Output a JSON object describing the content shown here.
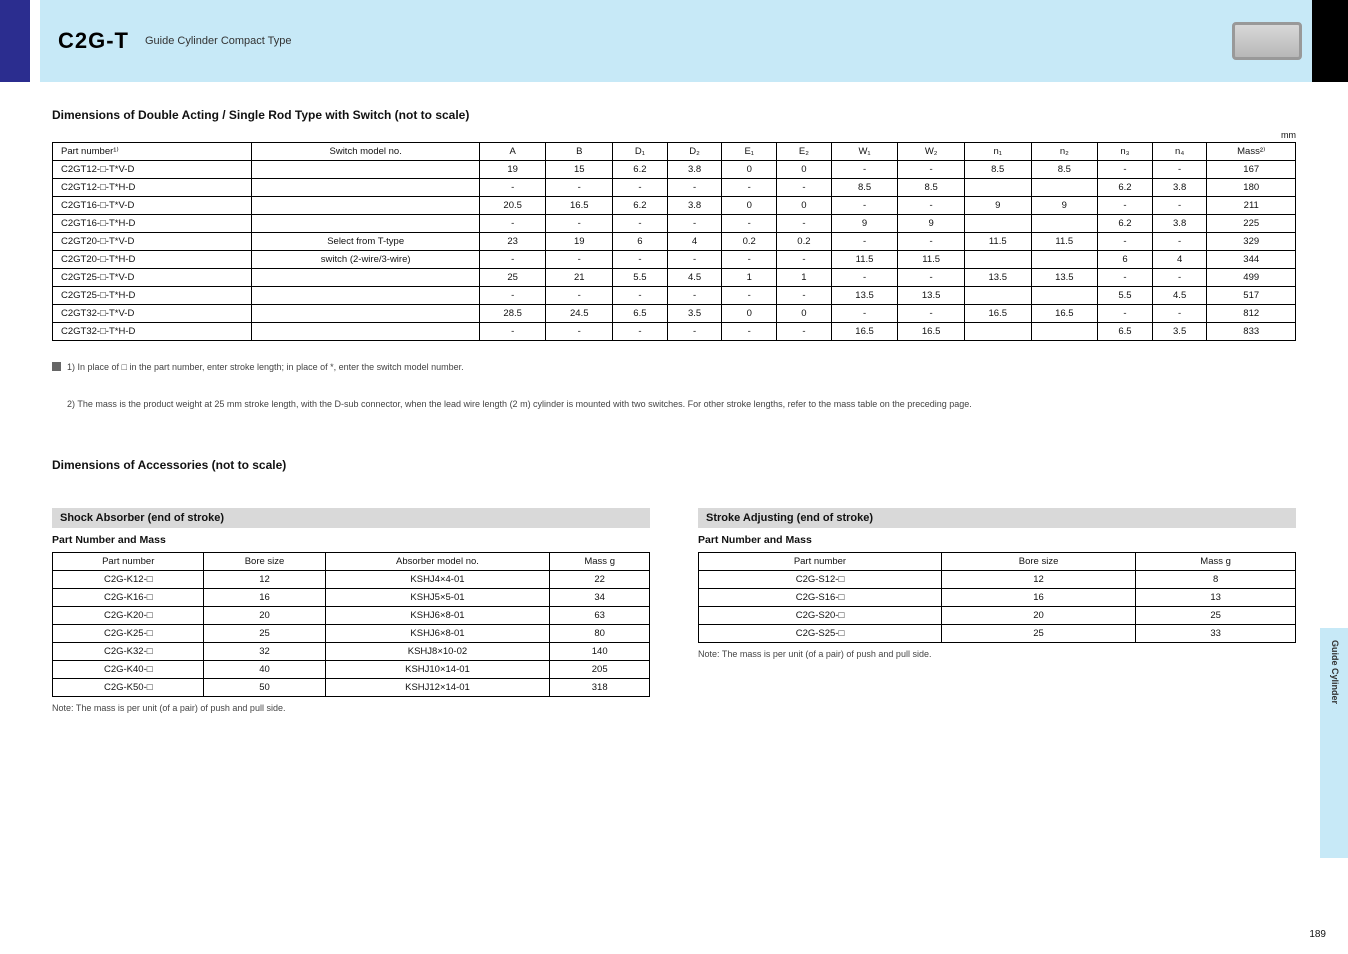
{
  "header": {
    "series": "C2G-T",
    "subtitle": "Guide Cylinder Compact Type",
    "side_tab": "Guide Cylinder",
    "page_number": "189"
  },
  "main_table": {
    "title": "Dimensions of Double Acting / Single Rod Type with Switch (not to scale)",
    "unit_note": "mm",
    "headers_row1": [
      "Part number¹⁾",
      "Switch model no.",
      "A",
      "B",
      "D₁",
      "D₂",
      "E₁",
      "E₂",
      "W₁",
      "W₂",
      "n₁",
      "n₂",
      "n₃",
      "n₄",
      "Mass²⁾"
    ],
    "rows": [
      [
        "C2GT12-□-T*V-D",
        "",
        "19",
        "15",
        "6.2",
        "3.8",
        "0",
        "0",
        "-",
        "-",
        "8.5",
        "8.5",
        "-",
        "-",
        "167"
      ],
      [
        "C2GT12-□-T*H-D",
        "",
        "-",
        "-",
        "-",
        "-",
        "-",
        "-",
        "8.5",
        "8.5",
        "",
        "",
        "6.2",
        "3.8",
        "180"
      ],
      [
        "C2GT16-□-T*V-D",
        "",
        "20.5",
        "16.5",
        "6.2",
        "3.8",
        "0",
        "0",
        "-",
        "-",
        "9",
        "9",
        "-",
        "-",
        "211"
      ],
      [
        "C2GT16-□-T*H-D",
        "",
        "-",
        "-",
        "-",
        "-",
        "-",
        "-",
        "9",
        "9",
        "",
        "",
        "6.2",
        "3.8",
        "225"
      ],
      [
        "C2GT20-□-T*V-D",
        "Select from T-type",
        "23",
        "19",
        "6",
        "4",
        "0.2",
        "0.2",
        "-",
        "-",
        "11.5",
        "11.5",
        "-",
        "-",
        "329"
      ],
      [
        "C2GT20-□-T*H-D",
        "switch (2-wire/3-wire)",
        "-",
        "-",
        "-",
        "-",
        "-",
        "-",
        "11.5",
        "11.5",
        "",
        "",
        "6",
        "4",
        "344"
      ],
      [
        "C2GT25-□-T*V-D",
        "",
        "25",
        "21",
        "5.5",
        "4.5",
        "1",
        "1",
        "-",
        "-",
        "13.5",
        "13.5",
        "-",
        "-",
        "499"
      ],
      [
        "C2GT25-□-T*H-D",
        "",
        "-",
        "-",
        "-",
        "-",
        "-",
        "-",
        "13.5",
        "13.5",
        "",
        "",
        "5.5",
        "4.5",
        "517"
      ],
      [
        "C2GT32-□-T*V-D",
        "",
        "28.5",
        "24.5",
        "6.5",
        "3.5",
        "0",
        "0",
        "-",
        "-",
        "16.5",
        "16.5",
        "-",
        "-",
        "812"
      ],
      [
        "C2GT32-□-T*H-D",
        "",
        "-",
        "-",
        "-",
        "-",
        "-",
        "-",
        "16.5",
        "16.5",
        "",
        "",
        "6.5",
        "3.5",
        "833"
      ]
    ],
    "notes": [
      "1) In place of □ in the part number, enter stroke length; in place of *, enter the switch model number.",
      "2) The mass is the product weight at 25 mm stroke length, with the D-sub connector, when the lead wire length (2 m) cylinder is mounted with two switches. For other stroke lengths, refer to the mass table on the preceding page."
    ]
  },
  "accessories_heading": "Dimensions of Accessories (not to scale)",
  "shock_absorber": {
    "bar": "Shock Absorber (end of stroke)",
    "sub": "Part Number and Mass",
    "headers": [
      "Part number",
      "Bore size",
      "Absorber model no.",
      "Mass g"
    ],
    "rows": [
      [
        "C2G-K12-□",
        "12",
        "KSHJ4×4-01",
        "22"
      ],
      [
        "C2G-K16-□",
        "16",
        "KSHJ5×5-01",
        "34"
      ],
      [
        "C2G-K20-□",
        "20",
        "KSHJ6×8-01",
        "63"
      ],
      [
        "C2G-K25-□",
        "25",
        "KSHJ6×8-01",
        "80"
      ],
      [
        "C2G-K32-□",
        "32",
        "KSHJ8×10-02",
        "140"
      ],
      [
        "C2G-K40-□",
        "40",
        "KSHJ10×14-01",
        "205"
      ],
      [
        "C2G-K50-□",
        "50",
        "KSHJ12×14-01",
        "318"
      ]
    ],
    "note": "Note: The mass is per unit (of a pair) of push and pull side."
  },
  "stroke_adjusting": {
    "bar": "Stroke Adjusting (end of stroke)",
    "sub": "Part Number and Mass",
    "headers": [
      "Part number",
      "Bore size",
      "Mass g"
    ],
    "rows": [
      [
        "C2G-S12-□",
        "12",
        "8"
      ],
      [
        "C2G-S16-□",
        "16",
        "13"
      ],
      [
        "C2G-S20-□",
        "20",
        "25"
      ],
      [
        "C2G-S25-□",
        "25",
        "33"
      ]
    ],
    "note": "Note: The mass is per unit (of a pair) of push and pull side."
  }
}
